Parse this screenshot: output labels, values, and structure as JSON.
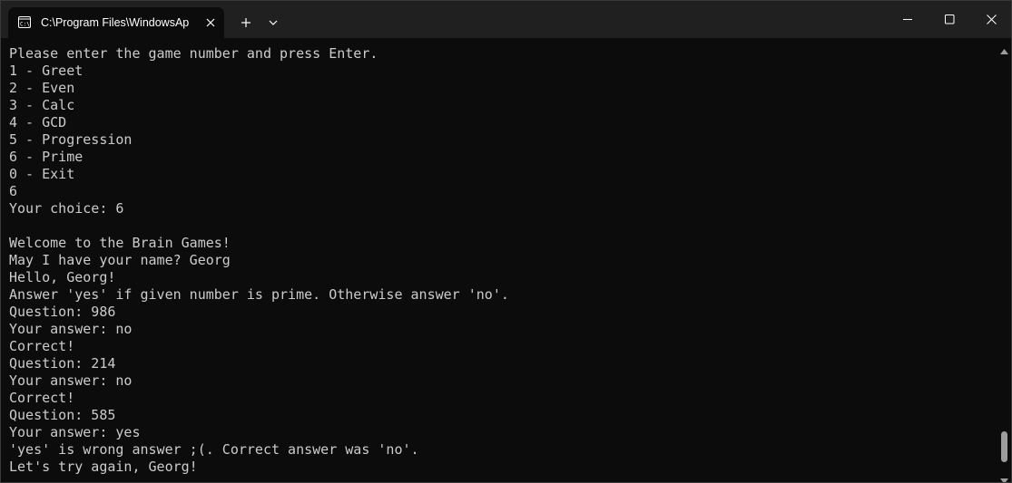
{
  "window": {
    "tab_title": "C:\\Program Files\\WindowsAp"
  },
  "icons": {
    "tab_icon": "terminal-icon",
    "tab_close": "close-icon",
    "new_tab": "plus-icon",
    "dropdown": "chevron-down-icon",
    "minimize": "minimize-icon",
    "maximize": "maximize-icon",
    "close": "close-icon",
    "scroll_up": "chevron-up-icon",
    "scroll_down": "chevron-down-icon"
  },
  "colors": {
    "background": "#0c0c0c",
    "titlebar": "#202020",
    "text": "#cccccc"
  },
  "terminal": {
    "lines": [
      "Please enter the game number and press Enter.",
      "1 - Greet",
      "2 - Even",
      "3 - Calc",
      "4 - GCD",
      "5 - Progression",
      "6 - Prime",
      "0 - Exit",
      "6",
      "Your choice: 6",
      "",
      "Welcome to the Brain Games!",
      "May I have your name? Georg",
      "Hello, Georg!",
      "Answer 'yes' if given number is prime. Otherwise answer 'no'.",
      "Question: 986",
      "Your answer: no",
      "Correct!",
      "Question: 214",
      "Your answer: no",
      "Correct!",
      "Question: 585",
      "Your answer: yes",
      "'yes' is wrong answer ;(. Correct answer was 'no'.",
      "Let's try again, Georg!"
    ]
  }
}
